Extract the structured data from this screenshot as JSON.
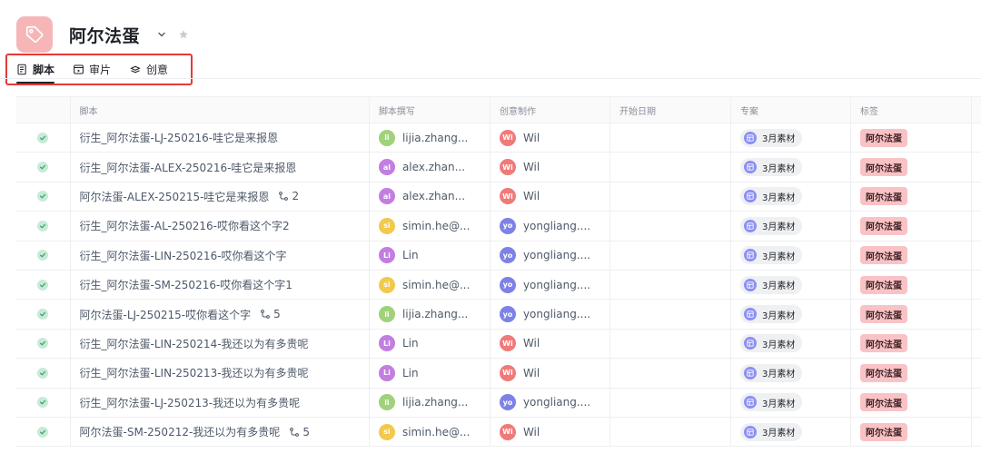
{
  "header": {
    "title": "阿尔法蛋",
    "icon": "tag-icon",
    "icon_bg": "#f6b6b8"
  },
  "tabs": [
    {
      "label": "脚本",
      "icon": "script-icon",
      "active": true
    },
    {
      "label": "审片",
      "icon": "review-icon",
      "active": false
    },
    {
      "label": "创意",
      "icon": "idea-stack-icon",
      "active": false
    }
  ],
  "table": {
    "columns": [
      "",
      "脚本",
      "脚本撰写",
      "创意制作",
      "开始日期",
      "专案",
      "标签",
      ""
    ],
    "rows": [
      {
        "script": "衍生_阿尔法蛋-LJ-250216-哇它是来报恩",
        "subtasks": "",
        "writer": {
          "initials": "li",
          "name": "lijia.zhang...",
          "color": "#9fd27a"
        },
        "maker": {
          "initials": "Wi",
          "name": "Wil",
          "color": "#f07a7a"
        },
        "start_date": "",
        "project": "3月素材",
        "tag": "阿尔法蛋"
      },
      {
        "script": "衍生_阿尔法蛋-ALEX-250216-哇它是来报恩",
        "subtasks": "",
        "writer": {
          "initials": "al",
          "name": "alex.zhan...",
          "color": "#c27ee0"
        },
        "maker": {
          "initials": "Wi",
          "name": "Wil",
          "color": "#f07a7a"
        },
        "start_date": "",
        "project": "3月素材",
        "tag": "阿尔法蛋"
      },
      {
        "script": "阿尔法蛋-ALEX-250215-哇它是来报恩",
        "subtasks": "2",
        "writer": {
          "initials": "al",
          "name": "alex.zhan...",
          "color": "#c27ee0"
        },
        "maker": {
          "initials": "Wi",
          "name": "Wil",
          "color": "#f07a7a"
        },
        "start_date": "",
        "project": "3月素材",
        "tag": "阿尔法蛋"
      },
      {
        "script": "衍生_阿尔法蛋-AL-250216-哎你看这个字2",
        "subtasks": "",
        "writer": {
          "initials": "si",
          "name": "simin.he@...",
          "color": "#f2c94c"
        },
        "maker": {
          "initials": "yo",
          "name": "yongliang....",
          "color": "#7d82e6"
        },
        "start_date": "",
        "project": "3月素材",
        "tag": "阿尔法蛋"
      },
      {
        "script": "衍生_阿尔法蛋-LIN-250216-哎你看这个字",
        "subtasks": "",
        "writer": {
          "initials": "Li",
          "name": "Lin",
          "color": "#c27ee0"
        },
        "maker": {
          "initials": "yo",
          "name": "yongliang....",
          "color": "#7d82e6"
        },
        "start_date": "",
        "project": "3月素材",
        "tag": "阿尔法蛋"
      },
      {
        "script": "衍生_阿尔法蛋-SM-250216-哎你看这个字1",
        "subtasks": "",
        "writer": {
          "initials": "si",
          "name": "simin.he@...",
          "color": "#f2c94c"
        },
        "maker": {
          "initials": "yo",
          "name": "yongliang....",
          "color": "#7d82e6"
        },
        "start_date": "",
        "project": "3月素材",
        "tag": "阿尔法蛋"
      },
      {
        "script": "阿尔法蛋-LJ-250215-哎你看这个字",
        "subtasks": "5",
        "writer": {
          "initials": "li",
          "name": "lijia.zhang...",
          "color": "#9fd27a"
        },
        "maker": {
          "initials": "yo",
          "name": "yongliang....",
          "color": "#7d82e6"
        },
        "start_date": "",
        "project": "3月素材",
        "tag": "阿尔法蛋"
      },
      {
        "script": "衍生_阿尔法蛋-LIN-250214-我还以为有多贵呢",
        "subtasks": "",
        "writer": {
          "initials": "Li",
          "name": "Lin",
          "color": "#c27ee0"
        },
        "maker": {
          "initials": "Wi",
          "name": "Wil",
          "color": "#f07a7a"
        },
        "start_date": "",
        "project": "3月素材",
        "tag": "阿尔法蛋"
      },
      {
        "script": "衍生_阿尔法蛋-LIN-250213-我还以为有多贵呢",
        "subtasks": "",
        "writer": {
          "initials": "Li",
          "name": "Lin",
          "color": "#c27ee0"
        },
        "maker": {
          "initials": "Wi",
          "name": "Wil",
          "color": "#f07a7a"
        },
        "start_date": "",
        "project": "3月素材",
        "tag": "阿尔法蛋"
      },
      {
        "script": "衍生_阿尔法蛋-LJ-250213-我还以为有多贵呢",
        "subtasks": "",
        "writer": {
          "initials": "li",
          "name": "lijia.zhang...",
          "color": "#9fd27a"
        },
        "maker": {
          "initials": "yo",
          "name": "yongliang....",
          "color": "#7d82e6"
        },
        "start_date": "",
        "project": "3月素材",
        "tag": "阿尔法蛋"
      },
      {
        "script": "阿尔法蛋-SM-250212-我还以为有多贵呢",
        "subtasks": "5",
        "writer": {
          "initials": "si",
          "name": "simin.he@...",
          "color": "#f2c94c"
        },
        "maker": {
          "initials": "Wi",
          "name": "Wil",
          "color": "#f07a7a"
        },
        "start_date": "",
        "project": "3月素材",
        "tag": "阿尔法蛋"
      }
    ]
  },
  "colors": {
    "status_done": "#c8ead8",
    "tag_bg": "#f9c3c5",
    "project_chip_icon": "#8b8ff5",
    "highlight_border": "#e53935"
  }
}
